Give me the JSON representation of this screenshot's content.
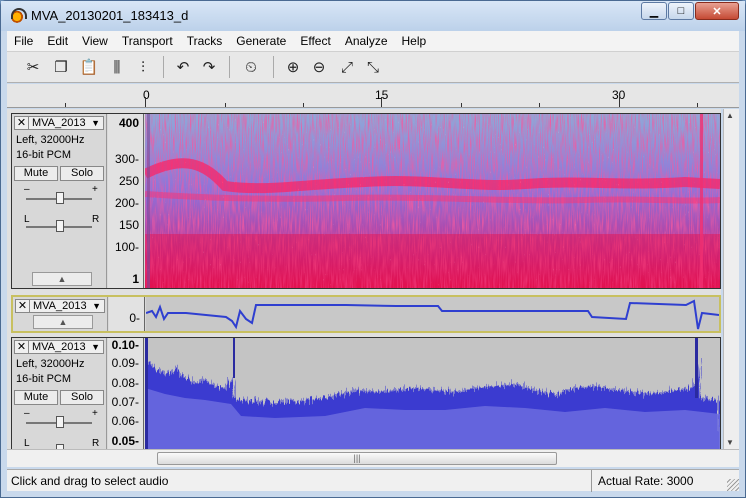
{
  "window": {
    "title": "MVA_20130201_183413_d",
    "minimize": "▁",
    "maximize": "□",
    "close": "✕"
  },
  "menu": [
    "File",
    "Edit",
    "View",
    "Transport",
    "Tracks",
    "Generate",
    "Effect",
    "Analyze",
    "Help"
  ],
  "toolbar": {
    "buttons": [
      {
        "name": "cut-icon",
        "glyph": "✂"
      },
      {
        "name": "copy-icon",
        "glyph": "❐"
      },
      {
        "name": "paste-icon",
        "glyph": "📋"
      },
      {
        "name": "trim-audio-icon",
        "glyph": "⫼"
      },
      {
        "name": "silence-audio-icon",
        "glyph": "⫶"
      },
      {
        "name": "undo-icon",
        "glyph": "↶"
      },
      {
        "name": "redo-icon",
        "glyph": "↷"
      },
      {
        "name": "sync-lock-icon",
        "glyph": "⏲"
      },
      {
        "name": "zoom-in-icon",
        "glyph": "⊕"
      },
      {
        "name": "zoom-out-icon",
        "glyph": "⊖"
      },
      {
        "name": "fit-selection-icon",
        "glyph": "⤢"
      },
      {
        "name": "fit-project-icon",
        "glyph": "⤡"
      }
    ]
  },
  "timeline": {
    "labels": [
      "0",
      "15",
      "30"
    ]
  },
  "tracks": [
    {
      "name": "MVA_2013",
      "info": [
        "Left, 32000Hz",
        "16-bit PCM"
      ],
      "mute": "Mute",
      "solo": "Solo",
      "gain_minus": "–",
      "gain_plus": "+",
      "pan_left": "L",
      "pan_right": "R",
      "view": "spectrogram",
      "scale": [
        "400",
        "300-",
        "250",
        "200-",
        "150",
        "100-",
        "1"
      ]
    },
    {
      "name": "MVA_2013",
      "view": "pitch",
      "scale": [
        "0-"
      ]
    },
    {
      "name": "MVA_2013",
      "info": [
        "Left, 32000Hz",
        "16-bit PCM"
      ],
      "mute": "Mute",
      "solo": "Solo",
      "gain_minus": "–",
      "gain_plus": "+",
      "pan_left": "L",
      "pan_right": "R",
      "view": "waveform",
      "scale": [
        "0.10-",
        "0.09-",
        "0.08-",
        "0.07-",
        "0.06-",
        "0.05-"
      ]
    }
  ],
  "scrollbar": {
    "grip": "|||"
  },
  "status": {
    "hint": "Click and drag to select audio",
    "rate": "Actual Rate: 3000"
  },
  "colors": {
    "spectro_hot": "#e8104a",
    "spectro_cold": "#7090e8",
    "wave_fill": "#3a3ad0",
    "wave_bg": "#c4c4c4",
    "pitch_line": "#2f3fd0"
  }
}
